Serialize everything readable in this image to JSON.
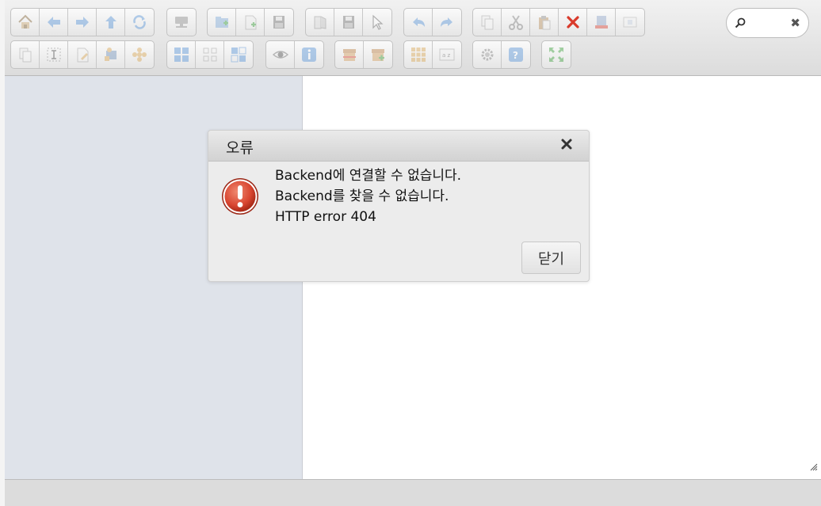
{
  "toolbar": {
    "row1": [
      {
        "icons": [
          "home-icon",
          "back-arrow-icon",
          "forward-arrow-icon",
          "up-arrow-icon",
          "reload-icon"
        ]
      },
      {
        "icons": [
          "netmount-icon"
        ]
      },
      {
        "icons": [
          "new-folder-icon",
          "new-file-icon",
          "upload-icon"
        ]
      },
      {
        "icons": [
          "open-icon",
          "download-icon",
          "select-icon"
        ]
      },
      {
        "icons": [
          "undo-icon",
          "redo-icon"
        ]
      },
      {
        "icons": [
          "copy-icon",
          "cut-icon",
          "paste-icon",
          "delete-icon",
          "empty-folder-icon",
          "duplicate-icon"
        ]
      }
    ],
    "row2": [
      {
        "icons": [
          "clone-icon",
          "rename-icon",
          "edit-file-icon",
          "resize-image-icon",
          "extract-icon"
        ]
      },
      {
        "icons": [
          "select-all-icon",
          "select-none-icon",
          "invert-selection-icon"
        ]
      },
      {
        "icons": [
          "preview-icon",
          "info-icon"
        ]
      },
      {
        "icons": [
          "archive-icon",
          "create-archive-icon"
        ]
      },
      {
        "icons": [
          "icons-view-icon",
          "sort-icon"
        ]
      },
      {
        "icons": [
          "preferences-icon",
          "help-icon"
        ]
      },
      {
        "icons": [
          "fullscreen-icon"
        ]
      }
    ],
    "search": {
      "placeholder": "",
      "value": ""
    }
  },
  "dialog": {
    "title": "오류",
    "messages": [
      "Backend에 연결할 수 없습니다.",
      "Backend를 찾을 수 없습니다.",
      "HTTP error 404"
    ],
    "close_button_label": "닫기"
  },
  "colors": {
    "icon_blue": "#4f8fd6",
    "delete_red": "#d93a2b",
    "error_red": "#d84530",
    "nav_bg": "#dfe3ea"
  }
}
